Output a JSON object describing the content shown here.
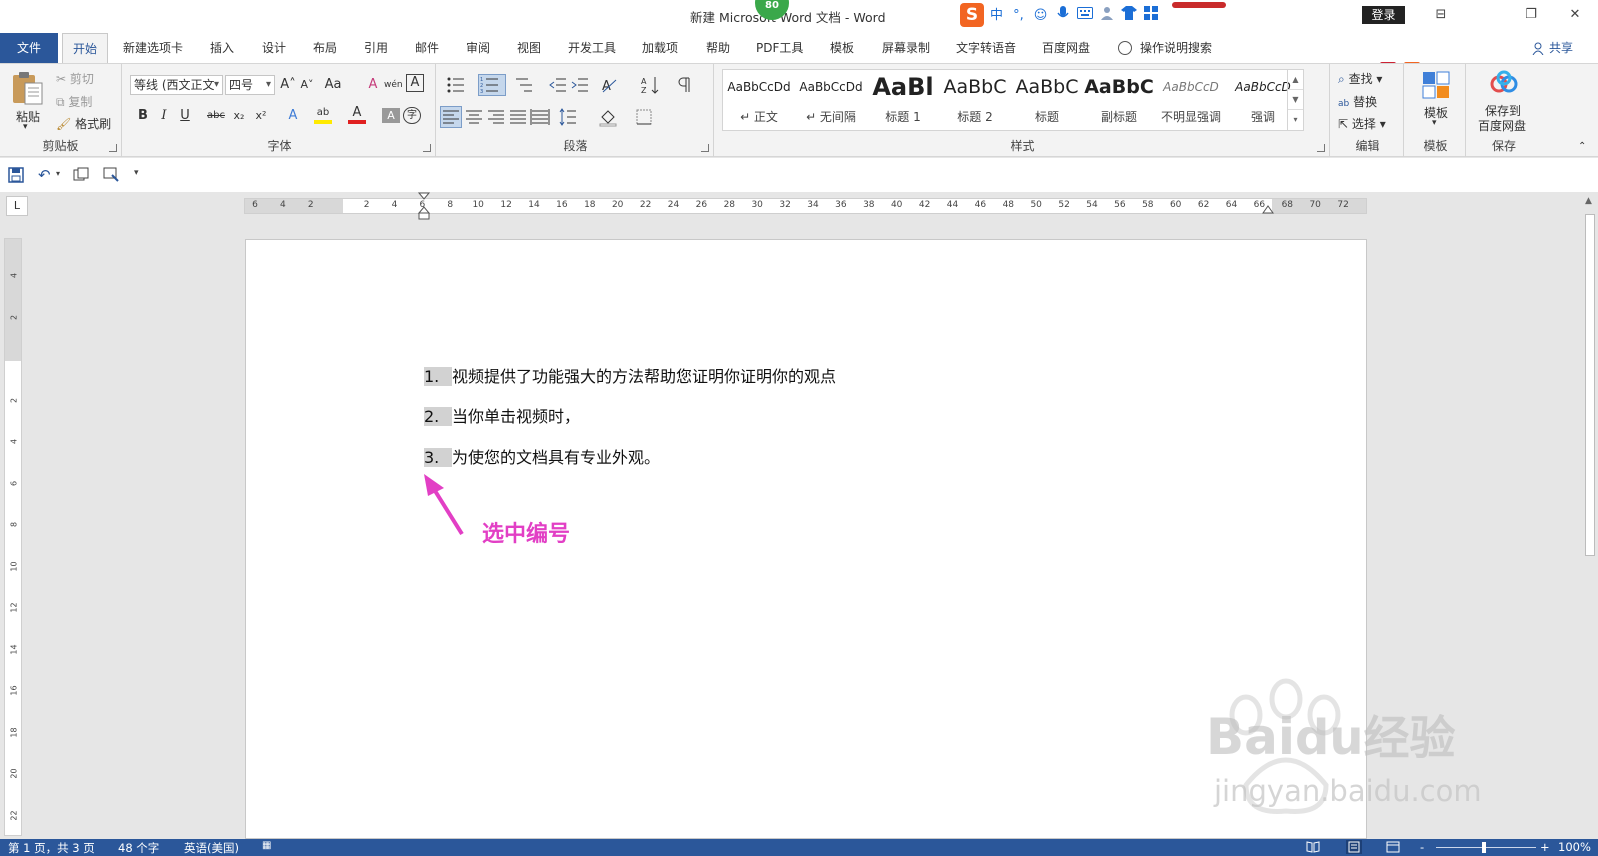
{
  "window": {
    "title": "新建 Microsoft Word 文档  -  Word",
    "badge": "80",
    "login": "登录",
    "controls": {
      "ribbon_options": "⊟",
      "restore": "❐",
      "close": "✕"
    }
  },
  "ime": {
    "logo": "S",
    "mode": "中",
    "punct": "°,",
    "smile": "☺",
    "mic": "🎤",
    "keyboard": "⌨",
    "user": "👤",
    "shirt": "👕",
    "grid": "▦"
  },
  "tabs": [
    "文件",
    "开始",
    "新建选项卡",
    "插入",
    "设计",
    "布局",
    "引用",
    "邮件",
    "审阅",
    "视图",
    "开发工具",
    "加载项",
    "帮助",
    "PDF工具",
    "模板",
    "屏幕录制",
    "文字转语音",
    "百度网盘"
  ],
  "tell_me": "操作说明搜索",
  "share": "共享",
  "ribbon": {
    "clipboard": {
      "paste": "粘贴",
      "cut": "剪切",
      "copy": "复制",
      "format_painter": "格式刷",
      "label": "剪贴板"
    },
    "font": {
      "font_name": "等线 (西文正文",
      "font_size": "四号",
      "grow": "A˄",
      "shrink": "A˅",
      "case": "Aa",
      "clear": "A",
      "phonetic": "wén",
      "border": "A",
      "bold": "B",
      "italic": "I",
      "underline": "U",
      "strike": "abc",
      "sub": "x₂",
      "sup": "x²",
      "effects": "A",
      "highlight": "ab",
      "color": "A",
      "shade": "A",
      "enclose": "字",
      "label": "字体"
    },
    "paragraph": {
      "label": "段落"
    },
    "styles": {
      "label": "样式",
      "items": [
        {
          "preview": "AaBbCcDd",
          "name": "↵ 正文"
        },
        {
          "preview": "AaBbCcDd",
          "name": "↵ 无间隔"
        },
        {
          "preview": "AaBl",
          "name": "标题 1"
        },
        {
          "preview": "AaBbC",
          "name": "标题 2"
        },
        {
          "preview": "AaBbC",
          "name": "标题"
        },
        {
          "preview": "AaBbC",
          "name": "副标题"
        },
        {
          "preview": "AaBbCcD",
          "name": "不明显强调"
        },
        {
          "preview": "AaBbCcD",
          "name": "强调"
        }
      ]
    },
    "editing": {
      "find": "查找",
      "replace": "替换",
      "select": "选择",
      "label": "编辑"
    },
    "template": {
      "button": "模板",
      "label": "模板"
    },
    "save": {
      "button_line1": "保存到",
      "button_line2": "百度网盘",
      "label": "保存"
    }
  },
  "ruler": {
    "h_ticks": [
      "6",
      "4",
      "2",
      "",
      "2",
      "4",
      "6",
      "8",
      "10",
      "12",
      "14",
      "16",
      "18",
      "20",
      "22",
      "24",
      "26",
      "28",
      "30",
      "32",
      "34",
      "36",
      "38",
      "40",
      "42",
      "44",
      "46",
      "48",
      "50",
      "52",
      "54",
      "56",
      "58",
      "60",
      "62",
      "64",
      "66",
      "68",
      "70",
      "72"
    ],
    "v_ticks": [
      "4",
      "2",
      "",
      "2",
      "4",
      "6",
      "8",
      "10",
      "12",
      "14",
      "16",
      "18",
      "20",
      "22"
    ],
    "corner": "L"
  },
  "document": {
    "lines": [
      {
        "num": "1.",
        "text": "视频提供了功能强大的方法帮助您证明你证明你的观点"
      },
      {
        "num": "2.",
        "text": "当你单击视频时，"
      },
      {
        "num": "3.",
        "text": "为使您的文档具有专业外观。"
      }
    ],
    "annotation": "选中编号",
    "annotation_color": "#e23fc5"
  },
  "watermark": {
    "line1": "Bai",
    "line2": "经验",
    "url": "jingyan.baidu.com"
  },
  "status": {
    "page": "第 1 页，共 3 页",
    "words": "48 个字",
    "language": "英语(美国)",
    "zoom": "100%",
    "minus": "-",
    "plus": "+"
  },
  "colors": {
    "accent": "#2b579a",
    "arrow": "#e23fc5"
  }
}
